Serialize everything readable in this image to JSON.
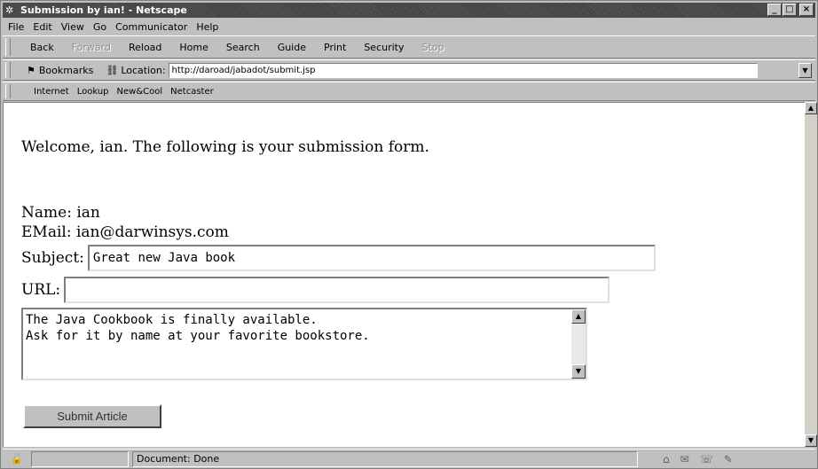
{
  "window": {
    "title": "Submission by ian! - Netscape",
    "controls": {
      "minimize": "_",
      "maximize": "□",
      "close": "×"
    }
  },
  "menu": [
    "File",
    "Edit",
    "View",
    "Go",
    "Communicator",
    "Help"
  ],
  "nav_toolbar": {
    "buttons": [
      {
        "label": "Back",
        "enabled": true
      },
      {
        "label": "Forward",
        "enabled": false
      },
      {
        "label": "Reload",
        "enabled": true
      },
      {
        "label": "Home",
        "enabled": true
      },
      {
        "label": "Search",
        "enabled": true
      },
      {
        "label": "Guide",
        "enabled": true
      },
      {
        "label": "Print",
        "enabled": true
      },
      {
        "label": "Security",
        "enabled": true
      },
      {
        "label": "Stop",
        "enabled": false
      }
    ]
  },
  "location_toolbar": {
    "bookmarks_label": "Bookmarks",
    "location_label": "Location:",
    "url": "http://daroad/jabadot/submit.jsp"
  },
  "personal_toolbar": [
    "Internet",
    "Lookup",
    "New&Cool",
    "Netcaster"
  ],
  "page": {
    "welcome": "Welcome, ian. The following is your submission form.",
    "name_line": "Name: ian",
    "email_line": "EMail: ian@darwinsys.com",
    "subject_label": "Subject:",
    "subject_value": "Great new Java book",
    "url_label": "URL:",
    "url_value": "",
    "body_text": "The Java Cookbook is finally available.\nAsk for it by name at your favorite bookstore.",
    "submit_label": "Submit Article"
  },
  "status": {
    "text": "Document: Done"
  },
  "icons": {
    "title": "netscape-icon",
    "bookmarks": "bookmark-icon",
    "location": "location-icon",
    "lock": "lock-icon"
  }
}
